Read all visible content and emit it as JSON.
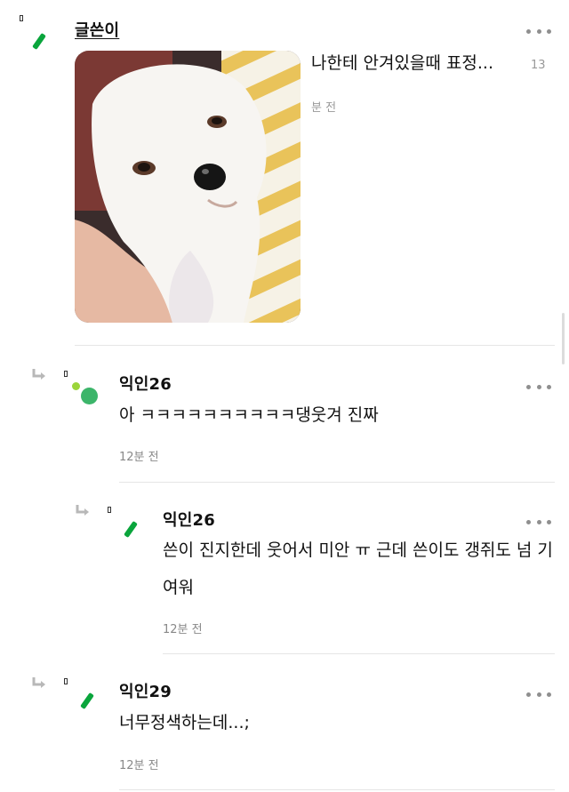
{
  "post": {
    "author": "글쓴이",
    "message": "나한테 안겨있을때 표정...",
    "count": "13",
    "time": "분 전"
  },
  "comments": [
    {
      "author": "익인26",
      "message": "아 ㅋㅋㅋㅋㅋㅋㅋㅋㅋㅋ댕웃겨 진짜",
      "time": "12분 전"
    },
    {
      "author": "익인26",
      "message": "쓴이 진지한데 웃어서 미안 ㅠ 근데 쓴이도 갱쥐도 넘 기여워",
      "time": "12분 전"
    },
    {
      "author": "익인29",
      "message": "너무정색하는데...;",
      "time": "12분 전"
    }
  ],
  "colors": {
    "accent_green": "#0aa53c",
    "avatar_green": "#3cb56a",
    "avatar_lime": "#9bd53a",
    "timestamp": "#888888"
  },
  "icons": {
    "more": "more-horizontal-icon",
    "reply": "reply-arrow-icon",
    "badge": "badge-icon"
  }
}
